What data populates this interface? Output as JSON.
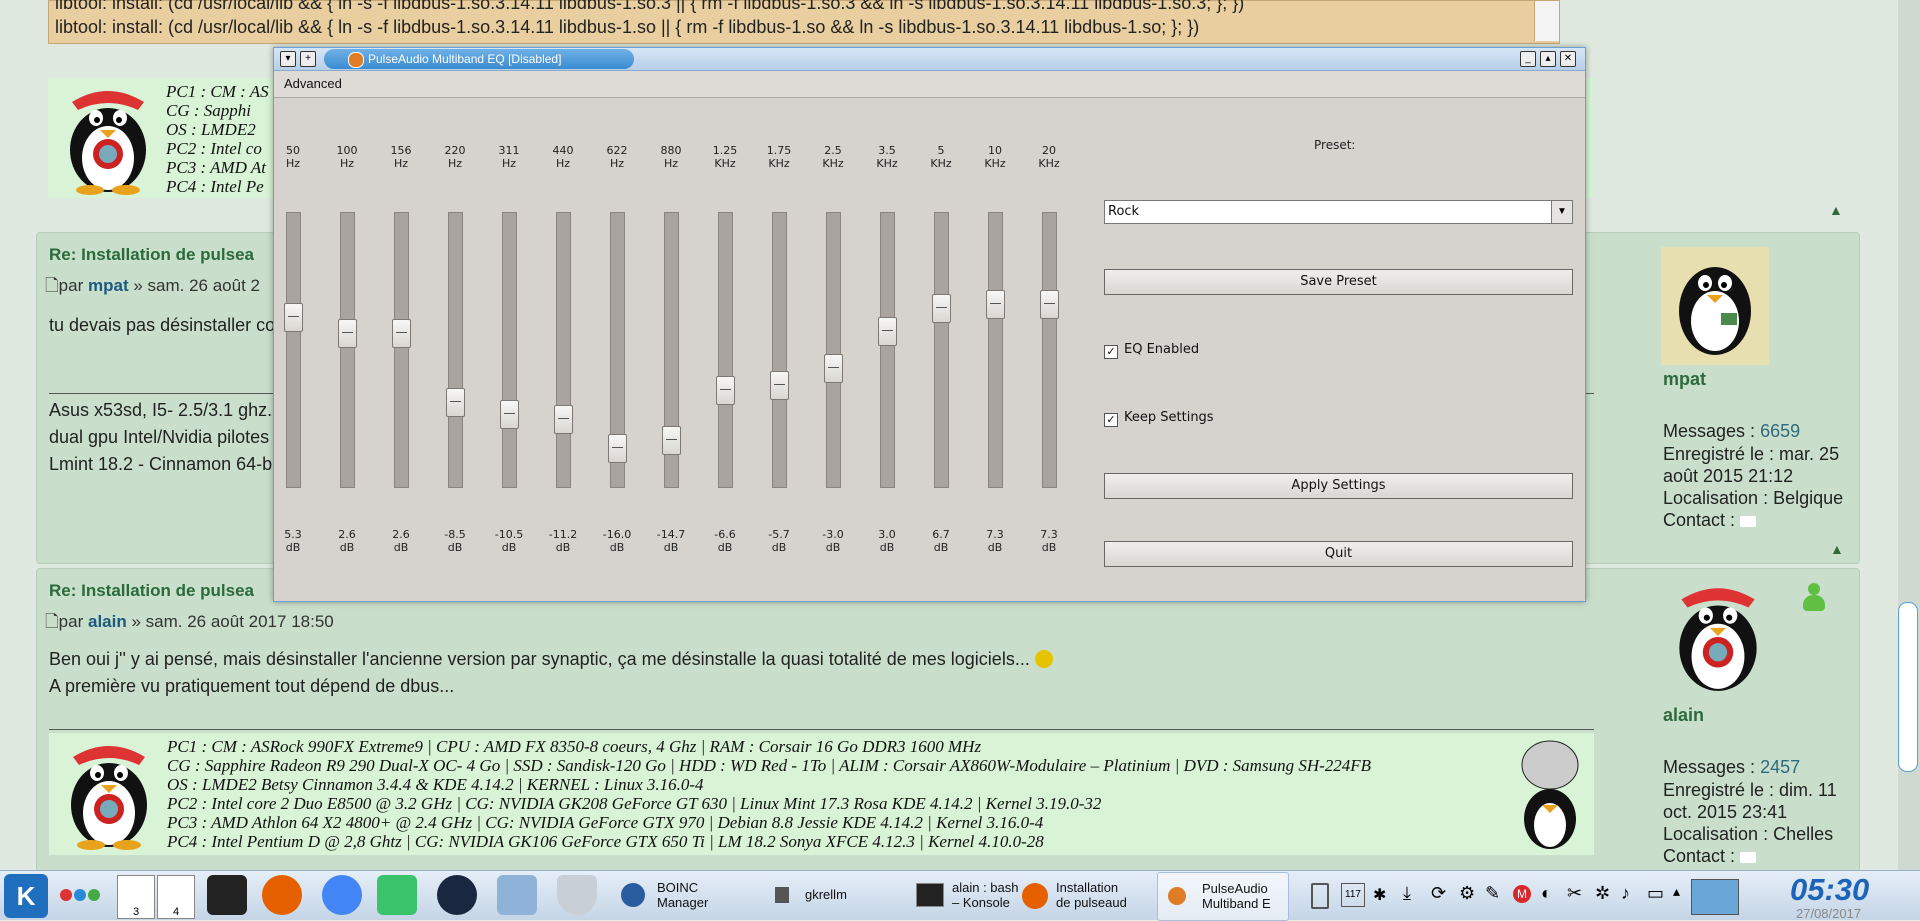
{
  "code_block": {
    "lines": [
      "libtool: install: (cd /usr/local/lib && { ln -s -f libdbus-1.so.3.14.11 libdbus-1.so.3 || { rm -f libdbus-1.so.3 && ln -s libdbus-1.so.3.14.11 libdbus-1.so.3; }; })",
      "libtool: install: (cd /usr/local/lib && { ln -s -f libdbus-1.so.3.14.11 libdbus-1.so || { rm -f libdbus-1.so && ln -s libdbus-1.so.3.14.11 libdbus-1.so; }; })"
    ]
  },
  "sig_top": {
    "lines": [
      "PC1 : CM : AS",
      "CG   : Sapphi",
      "OS   : LMDE2",
      "PC2 : Intel co",
      "PC3 : AMD At",
      "PC4 : Intel Pe"
    ]
  },
  "post_mpat": {
    "title": "Re: Installation de pulsea",
    "meta_prefix": "par",
    "author": "mpat",
    "meta_suffix": "» sam. 26 août 2",
    "text": "tu devais pas désinstaller co",
    "sig": [
      "Asus x53sd, I5- 2.5/3.1 ghz.",
      "dual gpu Intel/Nvidia pilotes",
      "Lmint 18.2 - Cinnamon 64-b"
    ],
    "profile": {
      "name": "mpat",
      "messages_label": "Messages :",
      "messages": "6659",
      "registered": "Enregistré le : mar. 25 août 2015 21:12",
      "registered_l1": "Enregistré le : mar. 25",
      "registered_l2": "août 2015 21:12",
      "location": "Localisation : Belgique",
      "contact": "Contact :"
    }
  },
  "post_alain": {
    "title": "Re: Installation de pulsea",
    "meta_prefix": "par",
    "author": "alain",
    "meta_suffix": "» sam. 26 août 2017 18:50",
    "text_l1": "Ben oui j'' y ai pensé, mais désinstaller l'ancienne version par synaptic, ça me désinstalle la quasi totalité de mes logiciels...",
    "text_l2": "A première vu pratiquement tout dépend de dbus...",
    "sig": [
      "PC1 : CM : ASRock 990FX Extreme9 | CPU : AMD FX 8350-8 coeurs, 4 Ghz | RAM : Corsair 16 Go DDR3 1600 MHz",
      "CG   : Sapphire Radeon R9 290 Dual-X OC- 4 Go | SSD : Sandisk-120 Go | HDD : WD Red - 1To |  ALIM : Corsair AX860W-Modulaire – Platinium | DVD : Samsung SH-224FB",
      "OS   : LMDE2 Betsy Cinnamon 3.4.4 & KDE 4.14.2 | KERNEL : Linux 3.16.0-4",
      "PC2 : Intel core 2 Duo E8500 @ 3.2 GHz | CG:  NVIDIA GK208 GeForce GT 630 | Linux Mint 17.3 Rosa KDE 4.14.2 | Kernel 3.19.0-32",
      "PC3 : AMD Athlon 64 X2 4800+ @ 2.4 GHz | CG: NVIDIA GeForce GTX 970 | Debian 8.8 Jessie KDE 4.14.2 | Kernel 3.16.0-4",
      "PC4 : Intel Pentium D @ 2,8 Ghtz | CG: NVIDIA GK106 GeForce GTX 650 Ti | LM 18.2 Sonya XFCE 4.12.3 | Kernel 4.10.0-28"
    ],
    "profile": {
      "name": "alain",
      "messages_label": "Messages :",
      "messages": "2457",
      "registered_l1": "Enregistré le : dim. 11",
      "registered_l2": "oct. 2015 23:41",
      "location": "Localisation : Chelles",
      "contact": "Contact :"
    }
  },
  "eq_window": {
    "title": "PulseAudio Multiband EQ [Disabled]",
    "menu": "Advanced",
    "bands": [
      {
        "freq": "50",
        "unit": "Hz",
        "gain": "5.3",
        "gain_value": 5.3
      },
      {
        "freq": "100",
        "unit": "Hz",
        "gain": "2.6",
        "gain_value": 2.6
      },
      {
        "freq": "156",
        "unit": "Hz",
        "gain": "2.6",
        "gain_value": 2.6
      },
      {
        "freq": "220",
        "unit": "Hz",
        "gain": "-8.5",
        "gain_value": -8.5
      },
      {
        "freq": "311",
        "unit": "Hz",
        "gain": "-10.5",
        "gain_value": -10.5
      },
      {
        "freq": "440",
        "unit": "Hz",
        "gain": "-11.2",
        "gain_value": -11.2
      },
      {
        "freq": "622",
        "unit": "Hz",
        "gain": "-16.0",
        "gain_value": -16.0
      },
      {
        "freq": "880",
        "unit": "Hz",
        "gain": "-14.7",
        "gain_value": -14.7
      },
      {
        "freq": "1.25",
        "unit": "KHz",
        "gain": "-6.6",
        "gain_value": -6.6
      },
      {
        "freq": "1.75",
        "unit": "KHz",
        "gain": "-5.7",
        "gain_value": -5.7
      },
      {
        "freq": "2.5",
        "unit": "KHz",
        "gain": "-3.0",
        "gain_value": -3.0
      },
      {
        "freq": "3.5",
        "unit": "KHz",
        "gain": "3.0",
        "gain_value": 3.0
      },
      {
        "freq": "5",
        "unit": "KHz",
        "gain": "6.7",
        "gain_value": 6.7
      },
      {
        "freq": "10",
        "unit": "KHz",
        "gain": "7.3",
        "gain_value": 7.3
      },
      {
        "freq": "20",
        "unit": "KHz",
        "gain": "7.3",
        "gain_value": 7.3
      }
    ],
    "gain_unit": "dB",
    "preset_label": "Preset:",
    "preset_value": "Rock",
    "save_preset": "Save Preset",
    "eq_enabled_label": "EQ Enabled",
    "eq_enabled": true,
    "keep_settings_label": "Keep Settings",
    "keep_settings": true,
    "apply_settings": "Apply Settings",
    "quit": "Quit"
  },
  "taskbar": {
    "desktop_1": "3",
    "desktop_2": "4",
    "boinc": "BOINC\nManager",
    "boinc_l1": "BOINC",
    "boinc_l2": "Manager",
    "gkrellm": "gkrellm",
    "konsole_l1": "alain : bash",
    "konsole_l2": "– Konsole",
    "firefox_l1": "Installation",
    "firefox_l2": "de pulseaud",
    "pulse_l1": "PulseAudio",
    "pulse_l2": "Multiband E",
    "tray_badge": "117",
    "clock": "05:30",
    "date": "27/08/2017"
  },
  "colors": {
    "accent": "#1d63b7",
    "forum_green": "#2e6a3c",
    "code_bg": "#e9cfa0",
    "signature_bg": "#d8f3d6"
  }
}
